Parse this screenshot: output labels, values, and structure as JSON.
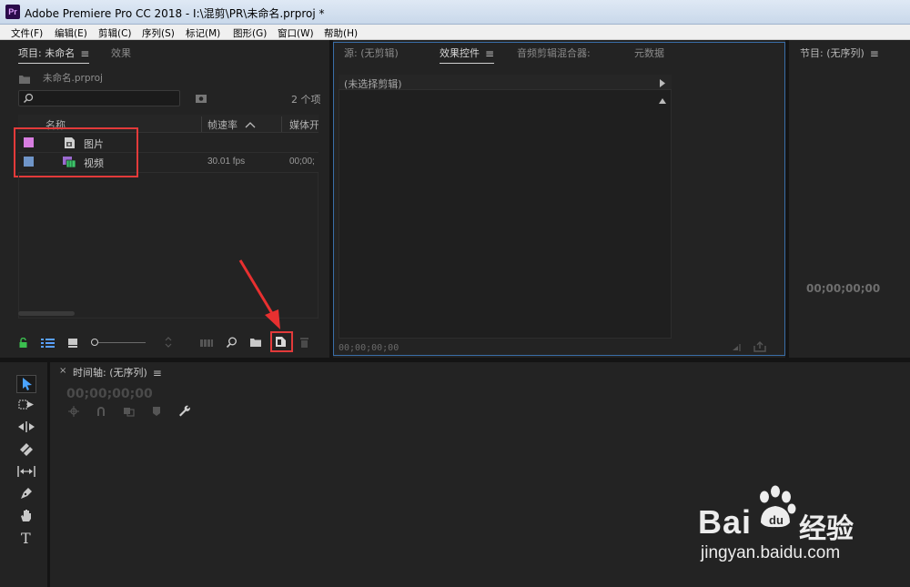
{
  "window": {
    "app_badge": "Pr",
    "title": "Adobe Premiere Pro CC 2018 - I:\\混剪\\PR\\未命名.prproj *"
  },
  "menu": [
    "文件(F)",
    "编辑(E)",
    "剪辑(C)",
    "序列(S)",
    "标记(M)",
    "图形(G)",
    "窗口(W)",
    "帮助(H)"
  ],
  "project_panel": {
    "tab_project": "项目: 未命名",
    "tab_effects": "效果",
    "file_name": "未命名.prproj",
    "search_placeholder": "",
    "item_count": "2 个项",
    "columns": {
      "name": "名称",
      "frame_rate": "帧速率",
      "media_start": "媒体开"
    },
    "items": [
      {
        "color": "#d77de0",
        "label": "图片",
        "frame_rate": "",
        "media_start": ""
      },
      {
        "color": "#6f95c8",
        "label": "视频",
        "frame_rate": "30.01 fps",
        "media_start": "00;00;"
      }
    ]
  },
  "source_panel": {
    "tab_source": "源: (无剪辑)",
    "tab_effect_controls": "效果控件",
    "tab_audio_mixer": "音频剪辑混合器:",
    "tab_metadata": "元数据",
    "no_clip_selected": "(未选择剪辑)",
    "timecode": "00;00;00;00"
  },
  "program_panel": {
    "tab": "节目: (无序列)",
    "timecode": "00;00;00;00"
  },
  "timeline_panel": {
    "tab": "时间轴: (无序列)",
    "timecode": "00;00;00;00"
  },
  "watermark": {
    "brand_left": "Bai",
    "brand_right": "经验",
    "url": "jingyan.baidu.com"
  }
}
